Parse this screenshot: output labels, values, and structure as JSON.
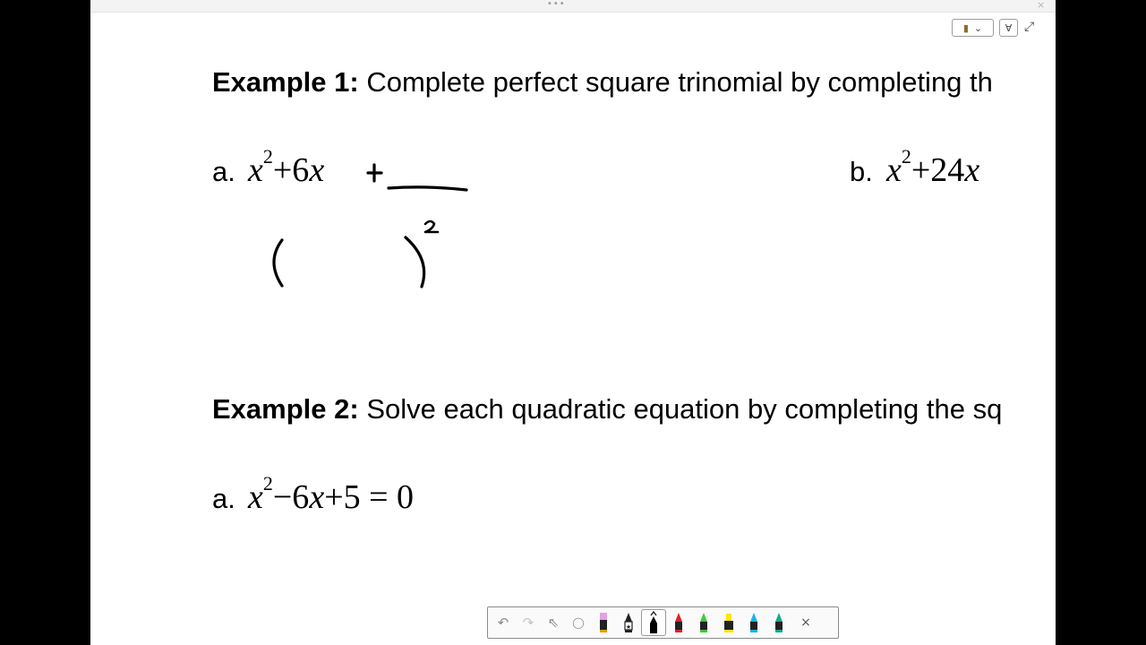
{
  "window": {
    "grip_glyph": "•••",
    "close_glyph": "×"
  },
  "controls": {
    "notebook_glyph": "▮",
    "dropdown_glyph": "⌄",
    "filter_glyph": "∀",
    "expand_glyph": "⤢"
  },
  "content": {
    "example1": {
      "label": "Example 1:",
      "text": "Complete perfect square trinomial by completing th",
      "a_label": "a.",
      "b_label": "b.",
      "a_expr": {
        "var": "x",
        "exp": "2",
        "rest": "+6",
        "var2": "x"
      },
      "b_expr": {
        "var": "x",
        "exp": "2",
        "rest": "+24",
        "var2": "x"
      }
    },
    "example2": {
      "label": "Example 2:",
      "text": "Solve each quadratic equation by completing the sq",
      "a_label": "a.",
      "a_expr": {
        "var": "x",
        "exp": "2",
        "mid": "−6",
        "var2": "x",
        "rest": "+5 = 0"
      }
    }
  },
  "toolbar": {
    "tools": [
      {
        "name": "undo",
        "glyph": "↶"
      },
      {
        "name": "redo",
        "glyph": "↷"
      },
      {
        "name": "select",
        "glyph": "⇖"
      },
      {
        "name": "lasso",
        "glyph": "◯"
      },
      {
        "name": "pen-pink",
        "color": "#e060c0"
      },
      {
        "name": "pen-star",
        "color": "#222222"
      },
      {
        "name": "pen-black",
        "color": "#000000",
        "selected": true
      },
      {
        "name": "pen-red",
        "color": "#e0202a"
      },
      {
        "name": "pen-green",
        "color": "#3cc83c"
      },
      {
        "name": "highlighter-yellow",
        "color": "#ffe600"
      },
      {
        "name": "pen-cyan",
        "color": "#18b4e6"
      },
      {
        "name": "pen-teal",
        "color": "#1aa890"
      }
    ],
    "close_glyph": "×"
  }
}
